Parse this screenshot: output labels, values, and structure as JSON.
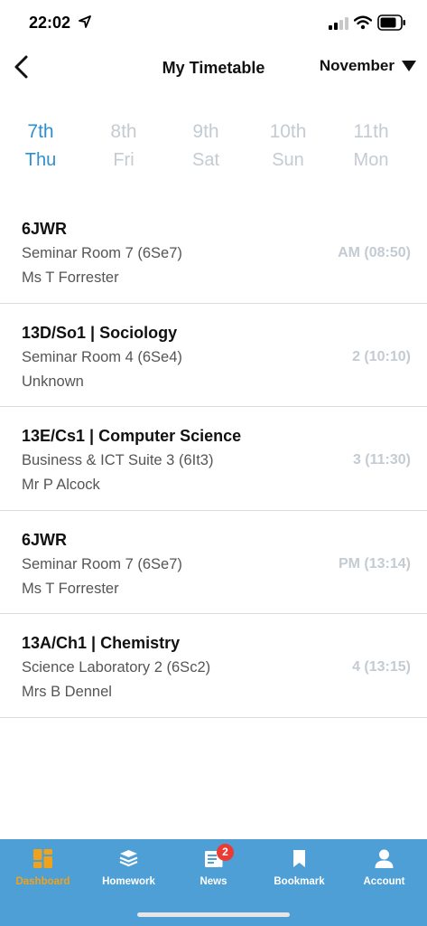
{
  "status_bar": {
    "time": "22:02"
  },
  "nav": {
    "title": "My Timetable",
    "month": "November"
  },
  "days": [
    {
      "num": "7th",
      "name": "Thu",
      "active": true
    },
    {
      "num": "8th",
      "name": "Fri",
      "active": false
    },
    {
      "num": "9th",
      "name": "Sat",
      "active": false
    },
    {
      "num": "10th",
      "name": "Sun",
      "active": false
    },
    {
      "num": "11th",
      "name": "Mon",
      "active": false
    }
  ],
  "lessons": [
    {
      "title": "6JWR",
      "room": "Seminar Room 7 (6Se7)",
      "teacher": "Ms T Forrester",
      "period": "AM (08:50)"
    },
    {
      "title": "13D/So1  |  Sociology",
      "room": "Seminar Room 4 (6Se4)",
      "teacher": "Unknown",
      "period": "2 (10:10)"
    },
    {
      "title": "13E/Cs1  |  Computer Science",
      "room": "Business & ICT Suite 3 (6It3)",
      "teacher": "Mr P Alcock",
      "period": "3 (11:30)"
    },
    {
      "title": "6JWR",
      "room": "Seminar Room 7 (6Se7)",
      "teacher": "Ms T Forrester",
      "period": "PM (13:14)"
    },
    {
      "title": "13A/Ch1  |  Chemistry",
      "room": "Science Laboratory 2 (6Sc2)",
      "teacher": "Mrs B Dennel",
      "period": "4 (13:15)"
    }
  ],
  "tabs": [
    {
      "label": "Dashboard",
      "icon": "dashboard-icon",
      "active": true
    },
    {
      "label": "Homework",
      "icon": "homework-icon",
      "active": false
    },
    {
      "label": "News",
      "icon": "news-icon",
      "active": false,
      "badge": "2"
    },
    {
      "label": "Bookmark",
      "icon": "bookmark-icon",
      "active": false
    },
    {
      "label": "Account",
      "icon": "account-icon",
      "active": false
    }
  ],
  "colors": {
    "accent": "#2e8fd0",
    "tab_bar": "#4d9fd5",
    "tab_active": "#f0a21c",
    "badge": "#ea3b34",
    "muted": "#c4cbd2"
  }
}
